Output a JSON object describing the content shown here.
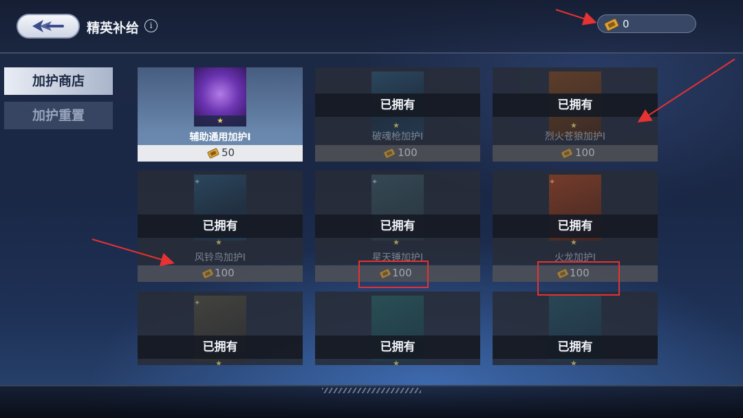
{
  "header": {
    "title": "精英补给",
    "info_icon": "i",
    "currency_value": "0"
  },
  "tabs": [
    {
      "label": "加护商店",
      "active": true
    },
    {
      "label": "加护重置",
      "active": false
    }
  ],
  "cards": [
    {
      "name": "辅助通用加护Ⅰ",
      "price": "50",
      "owned": false
    },
    {
      "name": "破魂枪加护Ⅰ",
      "price": "100",
      "owned": true,
      "owned_label": "已拥有"
    },
    {
      "name": "烈火苍狼加护Ⅰ",
      "price": "100",
      "owned": true,
      "owned_label": "已拥有"
    },
    {
      "name": "风铃鸟加护Ⅰ",
      "price": "100",
      "owned": true,
      "owned_label": "已拥有"
    },
    {
      "name": "星天锤加护Ⅰ",
      "price": "100",
      "owned": true,
      "owned_label": "已拥有"
    },
    {
      "name": "火龙加护Ⅰ",
      "price": "100",
      "owned": true,
      "owned_label": "已拥有"
    },
    {
      "owned": true,
      "owned_label": "已拥有"
    },
    {
      "owned": true,
      "owned_label": "已拥有"
    },
    {
      "owned": true,
      "owned_label": "已拥有"
    }
  ],
  "colors": {
    "highlight_box": "#e53232",
    "annotation_arrow": "#e53232",
    "star": "#f1d46a"
  }
}
